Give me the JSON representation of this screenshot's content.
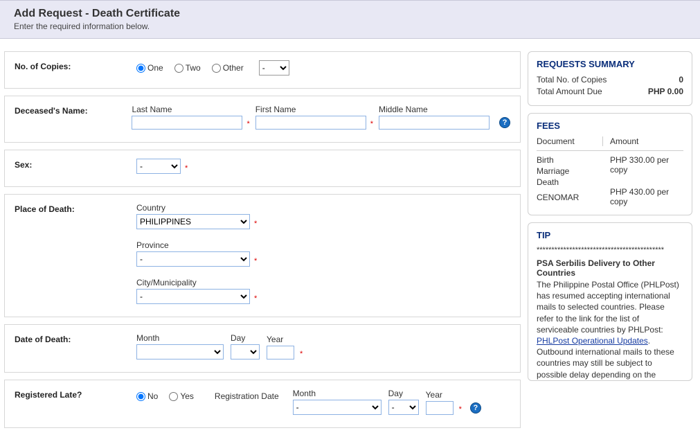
{
  "header": {
    "title": "Add Request - Death Certificate",
    "subtitle": "Enter the required information below."
  },
  "copies": {
    "label": "No. of Copies:",
    "options": {
      "one": "One",
      "two": "Two",
      "other": "Other"
    },
    "selected": "one",
    "other_values": [
      "-"
    ]
  },
  "deceased": {
    "label": "Deceased's Name:",
    "last_label": "Last Name",
    "first_label": "First Name",
    "middle_label": "Middle Name",
    "last": "",
    "first": "",
    "middle": ""
  },
  "sex": {
    "label": "Sex:",
    "value": "-",
    "options": [
      "-"
    ]
  },
  "place": {
    "label": "Place of Death:",
    "country_label": "Country",
    "country_value": "PHILIPPINES",
    "country_options": [
      "PHILIPPINES"
    ],
    "province_label": "Province",
    "province_value": "-",
    "province_options": [
      "-"
    ],
    "city_label": "City/Municipality",
    "city_value": "-",
    "city_options": [
      "-"
    ]
  },
  "death_date": {
    "label": "Date of Death:",
    "month_label": "Month",
    "day_label": "Day",
    "year_label": "Year",
    "month_value": "",
    "day_value": "",
    "year_value": ""
  },
  "late": {
    "label": "Registered Late?",
    "no": "No",
    "yes": "Yes",
    "selected": "no",
    "regdate_label": "Registration Date",
    "month_label": "Month",
    "day_label": "Day",
    "year_label": "Year",
    "month_value": "-",
    "day_value": "-",
    "year_value": ""
  },
  "summary": {
    "title": "REQUESTS SUMMARY",
    "copies_label": "Total No. of Copies",
    "copies_value": "0",
    "amount_label": "Total Amount Due",
    "amount_value": "PHP 0.00"
  },
  "fees": {
    "title": "FEES",
    "col_doc": "Document",
    "col_amt": "Amount",
    "rows": {
      "birth": "Birth",
      "marriage": "Marriage",
      "death": "Death",
      "cenomar": "CENOMAR",
      "amt1": "PHP 330.00 per copy",
      "amt2": "PHP 430.00 per copy"
    }
  },
  "tip": {
    "title": "TIP",
    "sep": "*******************************************",
    "head": "PSA Serbilis Delivery to Other Countries",
    "body1": "The Philippine Postal Office (PHLPost) has resumed accepting international mails to selected countries. Please refer to the link for the list of serviceable countries by PHLPost: ",
    "link": "PHLPost Operational Updates",
    "body2": ". Outbound international mails to these countries may still be subject to possible delay depending on the"
  }
}
